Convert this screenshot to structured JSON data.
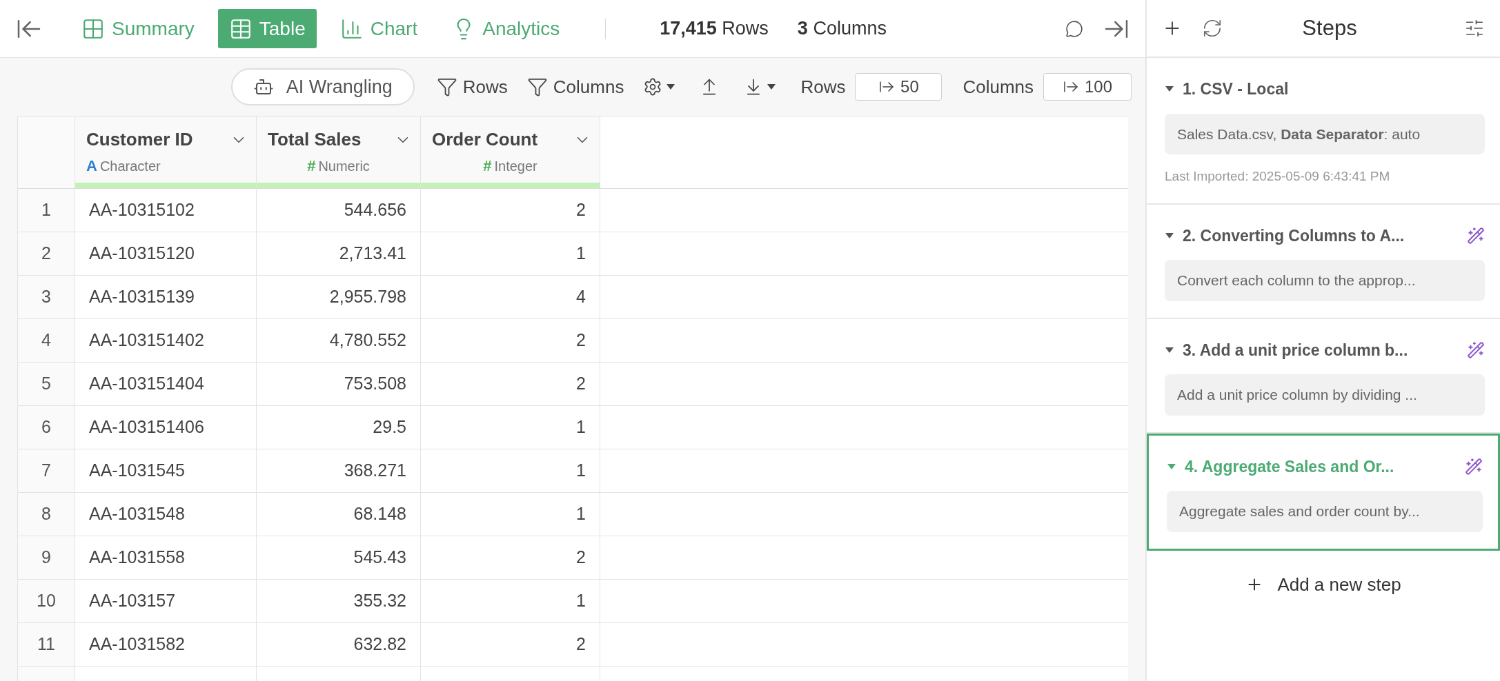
{
  "view_tabs": [
    {
      "label": "Summary",
      "kind": "summary",
      "selected": false
    },
    {
      "label": "Table",
      "kind": "table",
      "selected": true
    },
    {
      "label": "Chart",
      "kind": "chart",
      "selected": false
    },
    {
      "label": "Analytics",
      "kind": "analytics",
      "selected": false
    }
  ],
  "counts": [
    "**17,415** Rows",
    "**3** Columns"
  ],
  "toolbar": {
    "ai_button": "AI Wrangling",
    "filter_rows": "Rows",
    "filter_columns": "Columns",
    "rows_label": "Rows",
    "rows_value": "50",
    "columns_label": "Columns",
    "columns_value": "100"
  },
  "table": {
    "columns": [
      {
        "name": "Customer ID",
        "type": "Character",
        "type_glyph": "A",
        "kind": "character"
      },
      {
        "name": "Total Sales",
        "type": "Numeric",
        "type_glyph": "#",
        "kind": "numeric"
      },
      {
        "name": "Order Count",
        "type": "Integer",
        "type_glyph": "#",
        "kind": "numeric"
      }
    ],
    "rows": [
      {
        "number": "1",
        "cells": [
          "AA-10315102",
          "544.656",
          "2"
        ]
      },
      {
        "number": "2",
        "cells": [
          "AA-10315120",
          "2,713.41",
          "1"
        ]
      },
      {
        "number": "3",
        "cells": [
          "AA-10315139",
          "2,955.798",
          "4"
        ]
      },
      {
        "number": "4",
        "cells": [
          "AA-103151402",
          "4,780.552",
          "2"
        ]
      },
      {
        "number": "5",
        "cells": [
          "AA-103151404",
          "753.508",
          "2"
        ]
      },
      {
        "number": "6",
        "cells": [
          "AA-103151406",
          "29.5",
          "1"
        ]
      },
      {
        "number": "7",
        "cells": [
          "AA-1031545",
          "368.271",
          "1"
        ]
      },
      {
        "number": "8",
        "cells": [
          "AA-1031548",
          "68.148",
          "1"
        ]
      },
      {
        "number": "9",
        "cells": [
          "AA-1031558",
          "545.43",
          "2"
        ]
      },
      {
        "number": "10",
        "cells": [
          "AA-103157",
          "355.32",
          "1"
        ]
      },
      {
        "number": "11",
        "cells": [
          "AA-1031582",
          "632.82",
          "2"
        ]
      }
    ]
  },
  "steps_panel": {
    "title": "Steps",
    "add_step": "Add a new step",
    "steps": [
      {
        "title": "1. CSV - Local",
        "description": "Sales Data.csv, **Data Separator**: auto",
        "note": "Last Imported: 2025-05-09 6:43:41 PM",
        "ai": false,
        "expanded": true,
        "selected": false
      },
      {
        "title": "2. Converting Columns to A...",
        "description": "Convert each column to the approp...",
        "ai": true,
        "expanded": true,
        "selected": false
      },
      {
        "title": "3. Add a unit price column b...",
        "description": "Add a unit price column by dividing ...",
        "ai": true,
        "expanded": true,
        "selected": false
      },
      {
        "title": "4. Aggregate Sales and Or...",
        "description": "Aggregate sales and order count by...",
        "ai": true,
        "expanded": true,
        "selected": true
      }
    ]
  }
}
